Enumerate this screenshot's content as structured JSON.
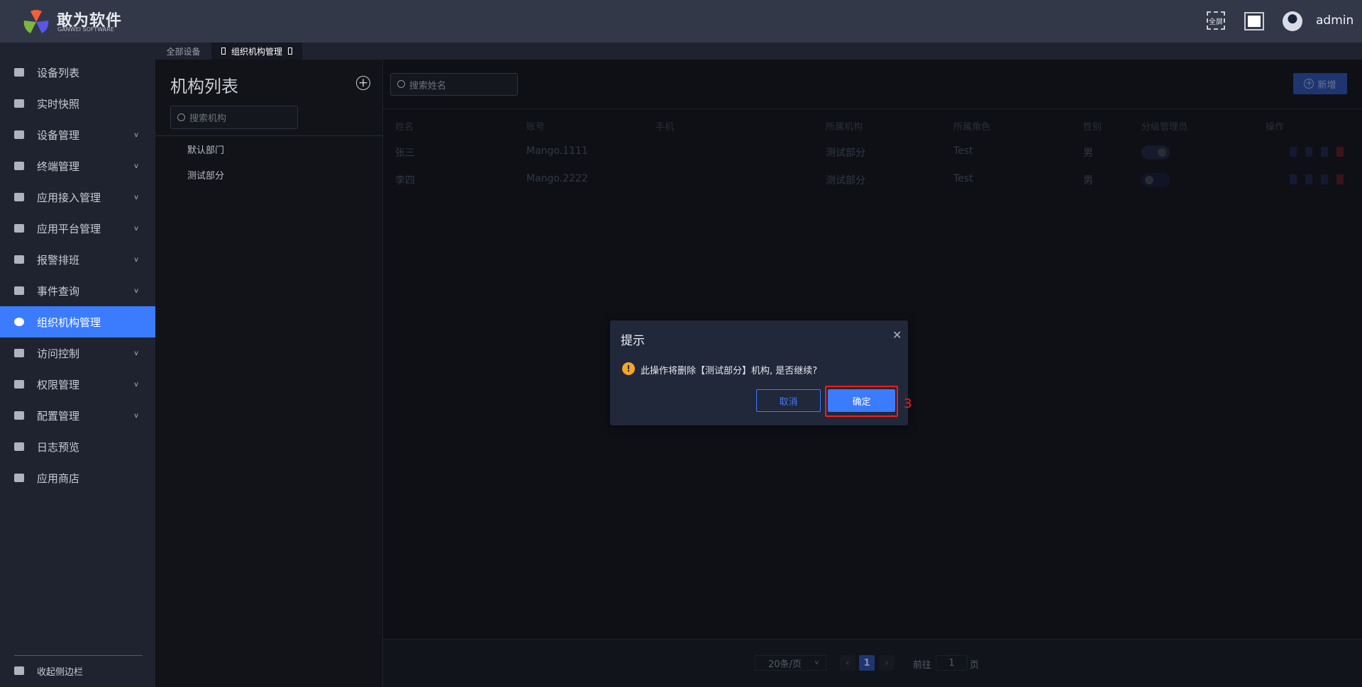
{
  "header": {
    "brand": "敢为软件",
    "brand_sub": "GANWEI SOFTWARE",
    "fullscreen_label": "全屏",
    "user": "admin"
  },
  "tabs": [
    {
      "label": "全部设备"
    },
    {
      "label": "组织机构管理"
    }
  ],
  "sidebar": {
    "items": [
      {
        "label": "设备列表",
        "icon": "monitor-icon",
        "chevron": false
      },
      {
        "label": "实时快照",
        "icon": "camera-icon",
        "chevron": false
      },
      {
        "label": "设备管理",
        "icon": "grid-icon",
        "chevron": true
      },
      {
        "label": "终端管理",
        "icon": "grid-icon",
        "chevron": true
      },
      {
        "label": "应用接入管理",
        "icon": "grid-icon",
        "chevron": true
      },
      {
        "label": "应用平台管理",
        "icon": "grid-icon",
        "chevron": true
      },
      {
        "label": "报警排班",
        "icon": "calendar-icon",
        "chevron": true
      },
      {
        "label": "事件查询",
        "icon": "search-doc-icon",
        "chevron": true
      },
      {
        "label": "组织机构管理",
        "icon": "gear-icon",
        "chevron": false,
        "active": true
      },
      {
        "label": "访问控制",
        "icon": "doc-icon",
        "chevron": true
      },
      {
        "label": "权限管理",
        "icon": "shield-icon",
        "chevron": true
      },
      {
        "label": "配置管理",
        "icon": "bookmark-icon",
        "chevron": true
      },
      {
        "label": "日志预览",
        "icon": "log-icon",
        "chevron": false
      },
      {
        "label": "应用商店",
        "icon": "store-icon",
        "chevron": false
      }
    ],
    "collapse_label": "收起侧边栏"
  },
  "org": {
    "title": "机构列表",
    "search_placeholder": "搜索机构",
    "items": [
      "默认部门",
      "测试部分"
    ]
  },
  "users": {
    "search_placeholder": "搜索姓名",
    "add_label": "新增",
    "columns": [
      "姓名",
      "账号",
      "手机",
      "所属机构",
      "所属角色",
      "性别",
      "分级管理员",
      "操作"
    ],
    "rows": [
      {
        "name": "张三",
        "account": "Mango.1111",
        "phone": "",
        "org": "测试部分",
        "role": "Test",
        "gender": "男",
        "admin": true
      },
      {
        "name": "李四",
        "account": "Mango.2222",
        "phone": "",
        "org": "测试部分",
        "role": "Test",
        "gender": "男",
        "admin": false
      }
    ]
  },
  "pagination": {
    "page_size": "20条/页",
    "current": "1",
    "goto_label": "前往",
    "goto_value": "1",
    "page_suffix": "页"
  },
  "dialog": {
    "title": "提示",
    "message": "此操作将删除【测试部分】机构, 是否继续?",
    "cancel": "取消",
    "confirm": "确定",
    "annotation": "3"
  },
  "colors": {
    "accent": "#3b7cff",
    "warning": "#f5a623",
    "highlight": "#ff1a1a"
  }
}
